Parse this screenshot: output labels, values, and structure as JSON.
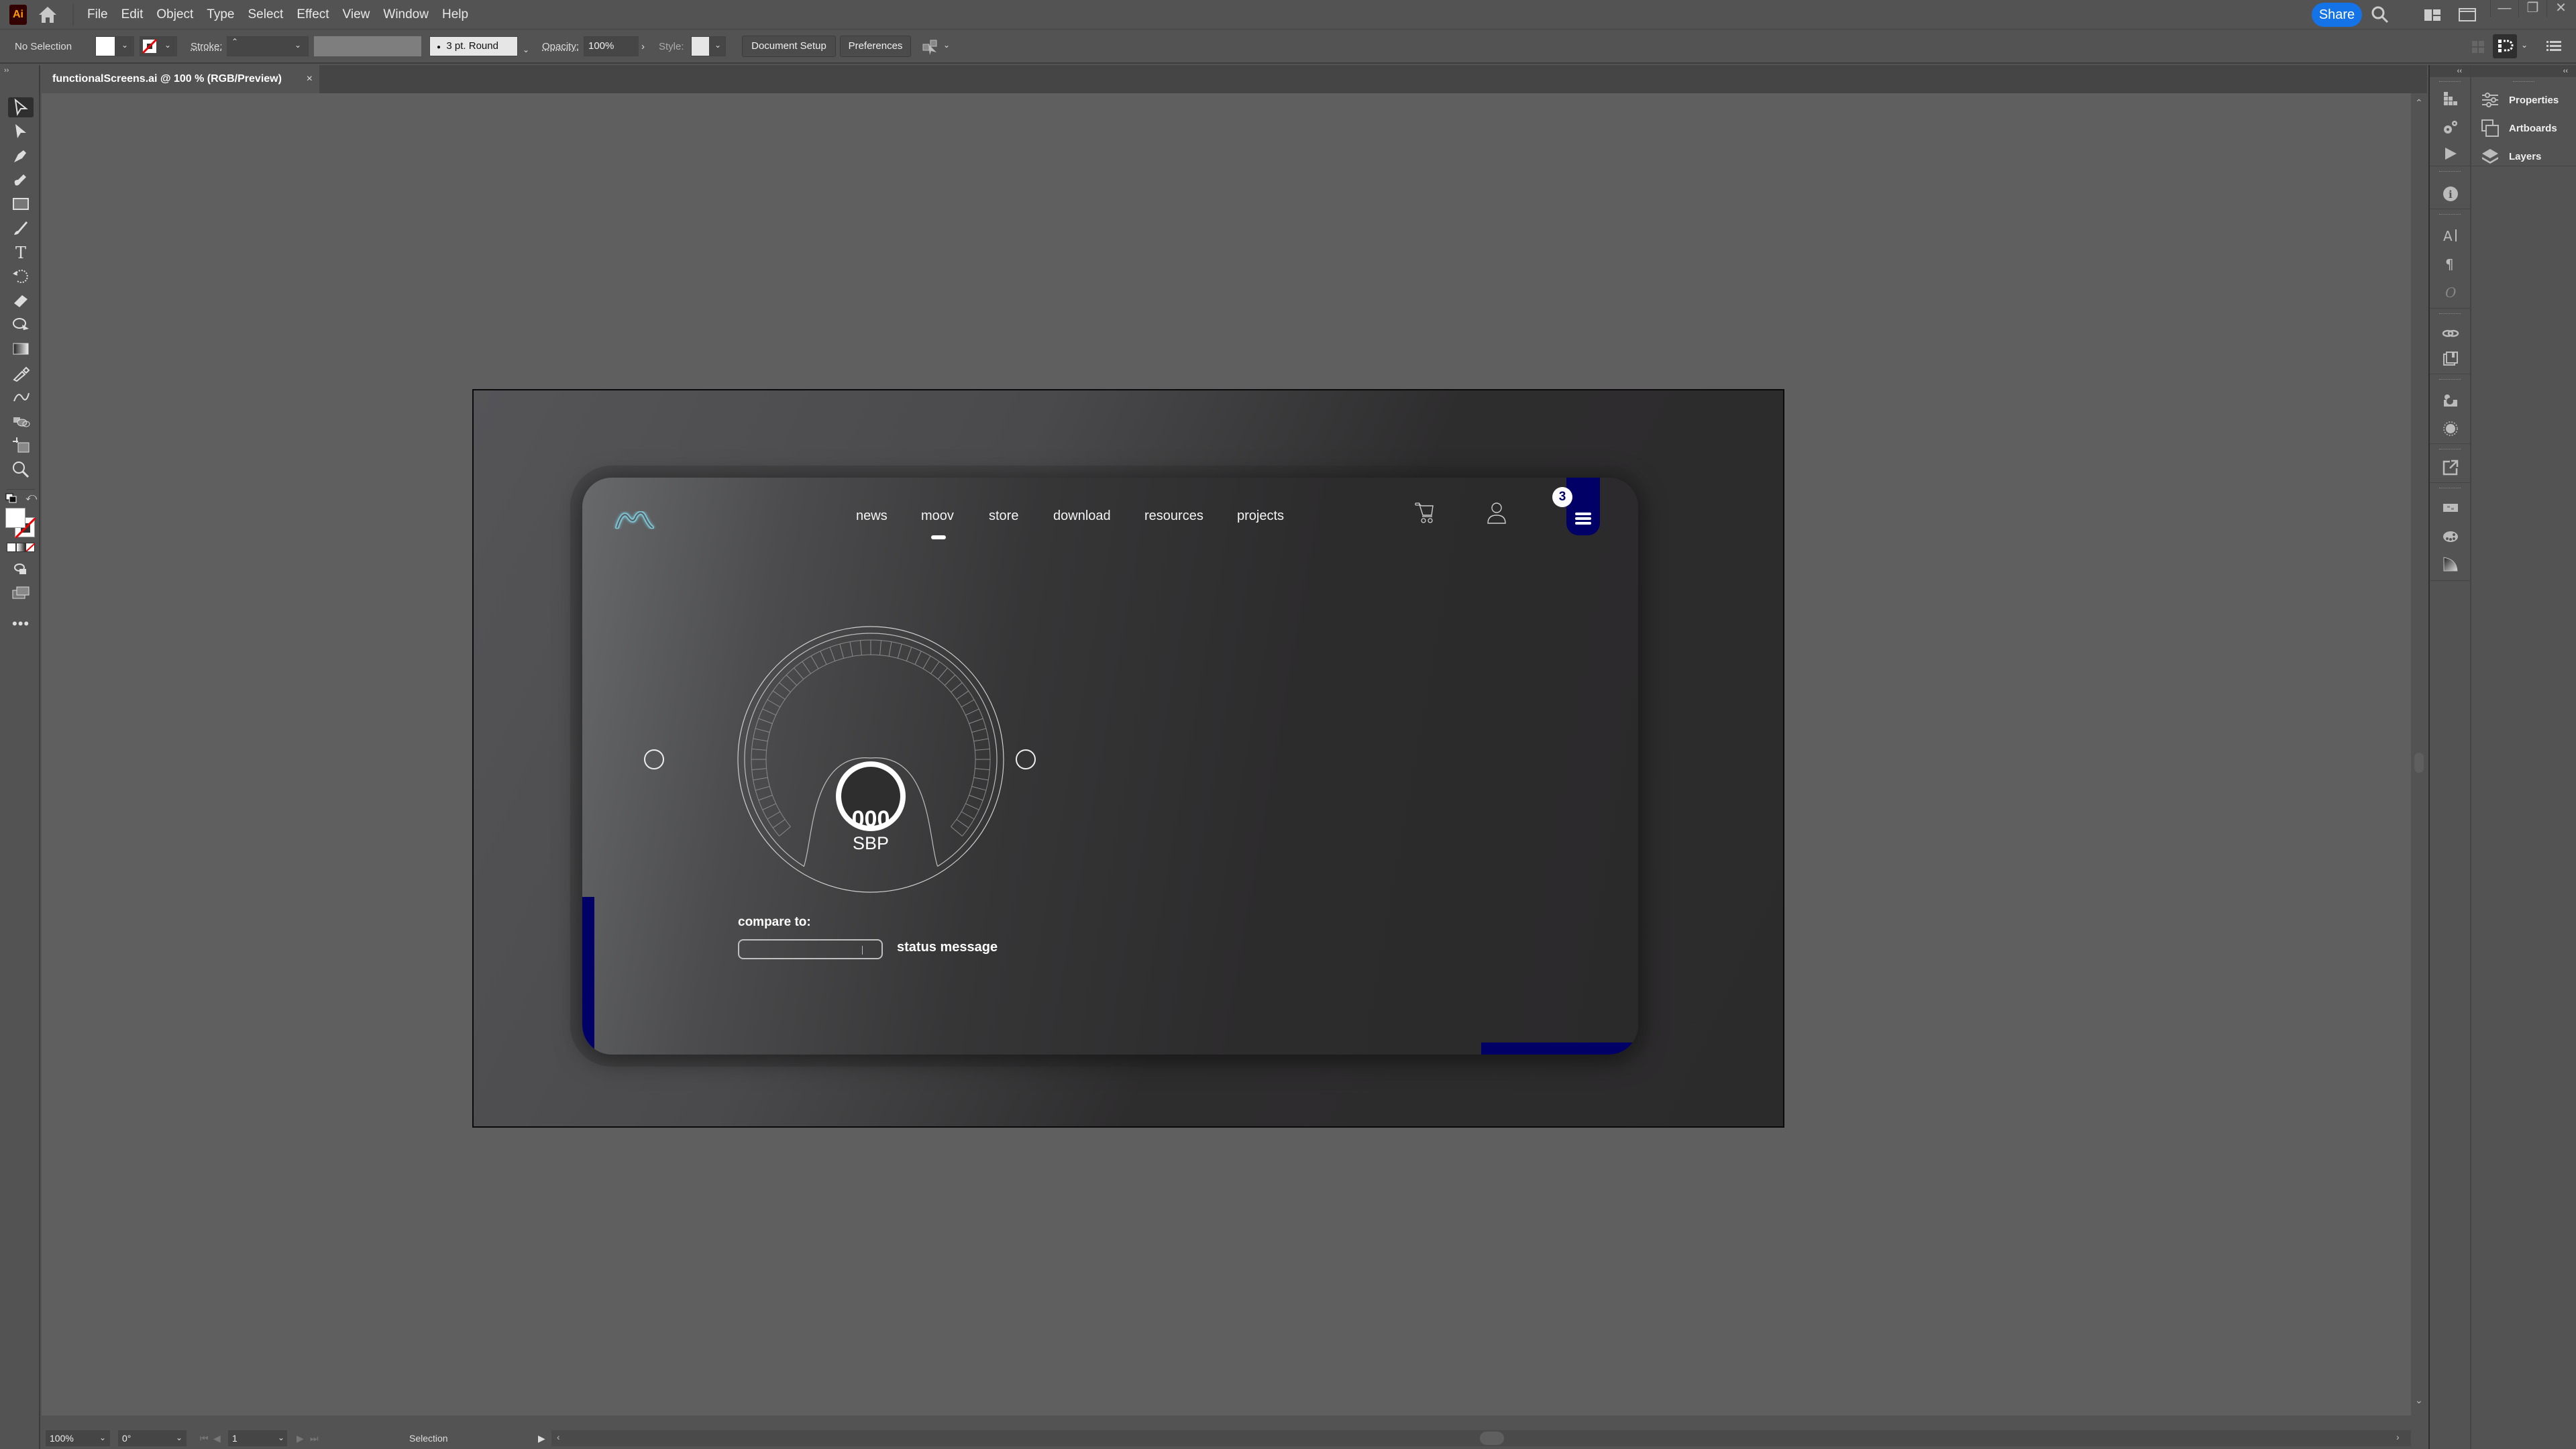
{
  "app": {
    "logo_text": "Ai",
    "menu": [
      "File",
      "Edit",
      "Object",
      "Type",
      "Select",
      "Effect",
      "View",
      "Window",
      "Help"
    ],
    "share_label": "Share"
  },
  "controlbar": {
    "selection_label": "No Selection",
    "stroke_label": "Stroke:",
    "brush_value": "3 pt. Round",
    "opacity_label": "Opacity:",
    "opacity_value": "100%",
    "style_label": "Style:",
    "document_setup_label": "Document Setup",
    "preferences_label": "Preferences"
  },
  "document": {
    "tab_title": "functionalScreens.ai @ 100 % (RGB/Preview)",
    "close_glyph": "×"
  },
  "artwork": {
    "nav_links": [
      "news",
      "moov",
      "store",
      "download",
      "resources",
      "projects"
    ],
    "active_link": "moov",
    "badge_count": "3",
    "gauge_value": "000",
    "gauge_unit": "SBP",
    "compare_label": "compare to:",
    "compare_input_value": "",
    "status_message": "status message",
    "accent_color": "#000066",
    "logo_color": "#7fd3e6"
  },
  "panels": {
    "properties_label": "Properties",
    "artboards_label": "Artboards",
    "layers_label": "Layers"
  },
  "statusbar": {
    "zoom_value": "100%",
    "rotation_value": "0°",
    "artboard_number": "1",
    "tool_name": "Selection"
  }
}
